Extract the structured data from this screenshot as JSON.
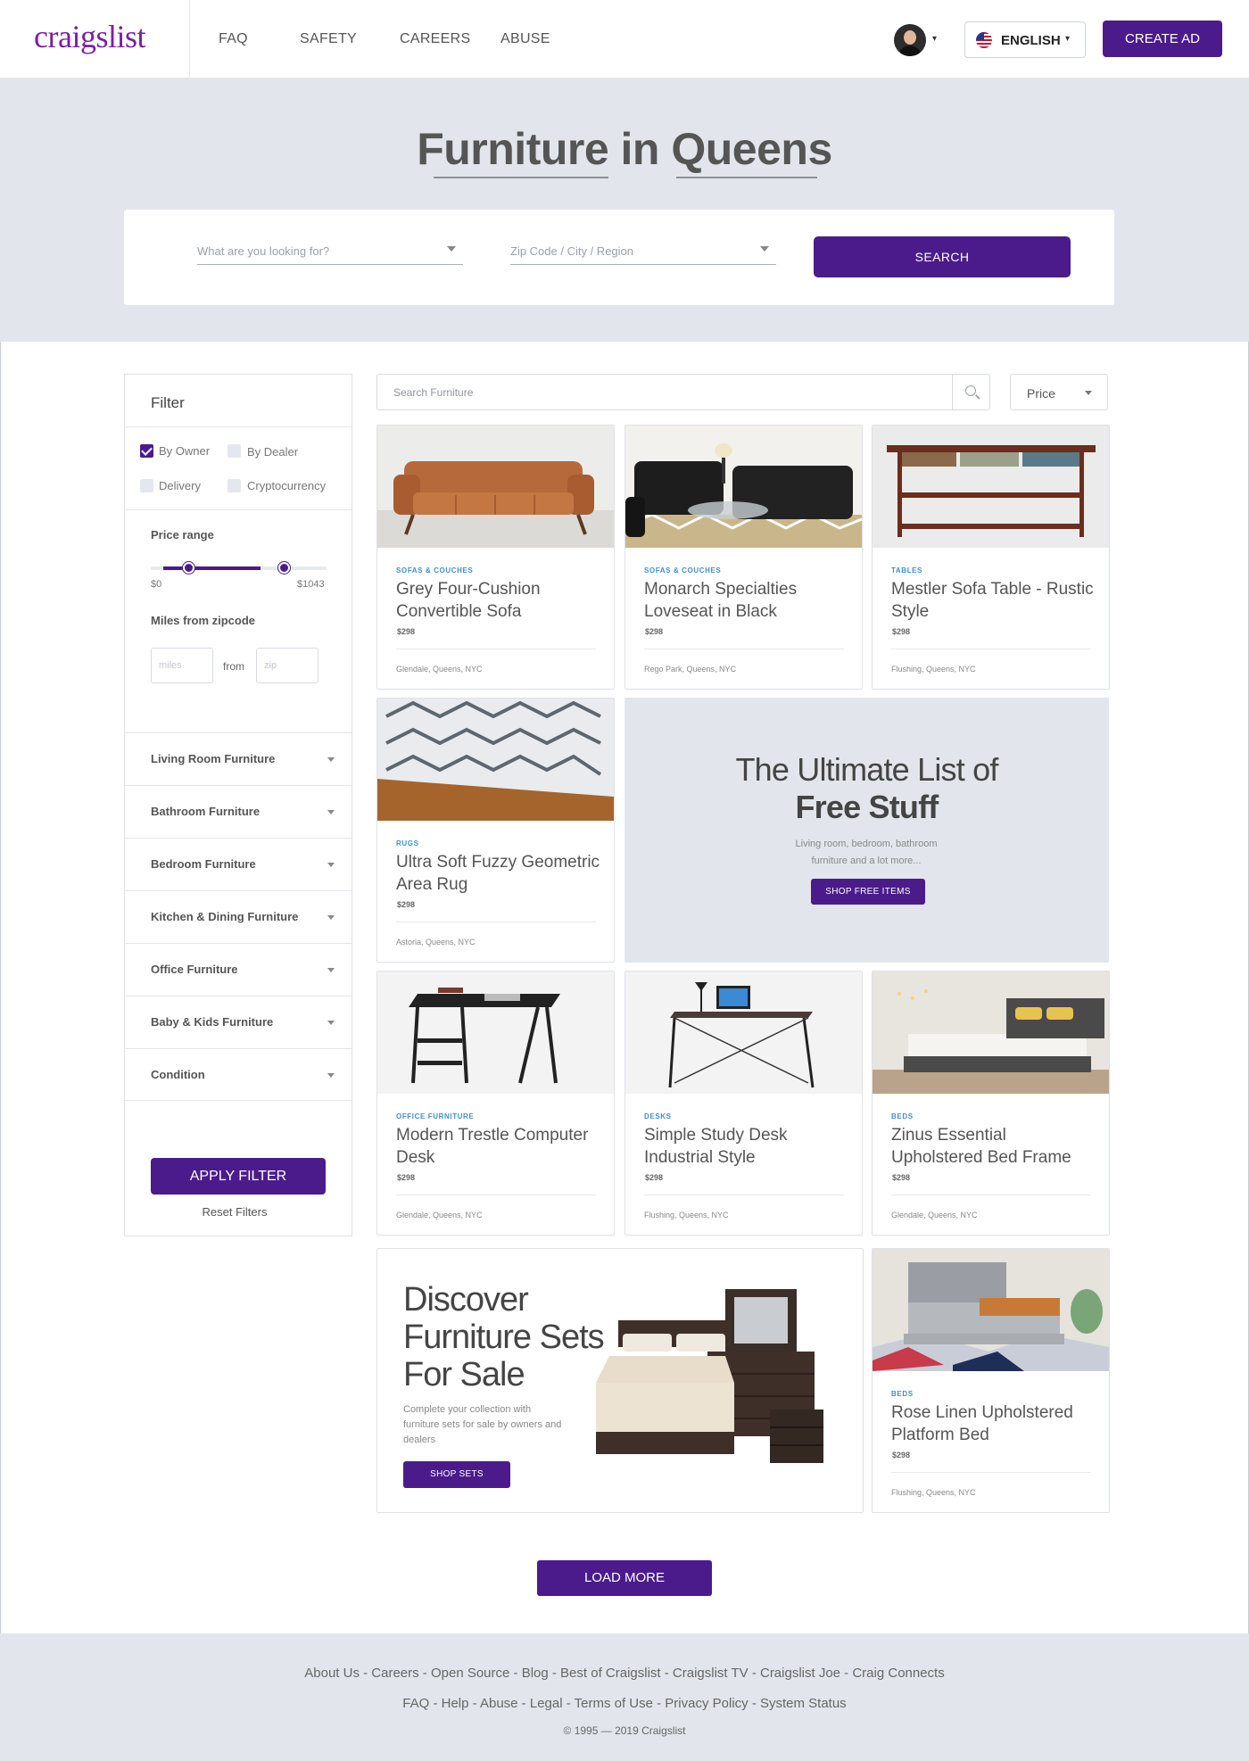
{
  "header": {
    "logo": "craigslist",
    "nav": [
      "FAQ",
      "SAFETY",
      "CAREERS",
      "ABUSE"
    ],
    "language": "ENGLISH",
    "create_ad": "CREATE AD"
  },
  "hero": {
    "title": "Furniture in Queens",
    "search_placeholder": "What are you looking for?",
    "location_placeholder": "Zip Code / City / Region",
    "search_button": "SEARCH"
  },
  "filter": {
    "title": "Filter",
    "checkboxes": [
      {
        "label": "By Owner",
        "checked": true
      },
      {
        "label": "By Dealer",
        "checked": false
      },
      {
        "label": "Delivery",
        "checked": false
      },
      {
        "label": "Cryptocurrency",
        "checked": false
      }
    ],
    "price_range_label": "Price range",
    "price_min": "$0",
    "price_max": "$1043",
    "miles_label": "Miles from zipcode",
    "miles_placeholder": "miles",
    "from_label": "from",
    "zip_placeholder": "zip",
    "categories": [
      "Living Room Furniture",
      "Bathroom Furniture",
      "Bedroom Furniture",
      "Kitchen & Dining Furniture",
      "Office Furniture",
      "Baby & Kids Furniture",
      "Condition"
    ],
    "apply_button": "APPLY FILTER",
    "reset_link": "Reset Filters"
  },
  "toolbar": {
    "search_placeholder": "Search Furniture",
    "sort_label": "Price"
  },
  "listings": [
    {
      "category": "SOFAS & COUCHES",
      "title": "Grey Four-Cushion Convertible Sofa",
      "price": "$298",
      "location": "Glendale, Queens, NYC"
    },
    {
      "category": "SOFAS & COUCHES",
      "title": "Monarch Specialties Loveseat in Black",
      "price": "$298",
      "location": "Rego Park, Queens, NYC"
    },
    {
      "category": "TABLES",
      "title": "Mestler Sofa Table - Rustic Style",
      "price": "$298",
      "location": "Flushing, Queens, NYC"
    },
    {
      "category": "RUGS",
      "title": "Ultra Soft Fuzzy Geometric Area Rug",
      "price": "$298",
      "location": "Astoria, Queens, NYC"
    },
    {
      "category": "OFFICE FURNITURE",
      "title": "Modern Trestle Computer Desk",
      "price": "$298",
      "location": "Glendale, Queens, NYC"
    },
    {
      "category": "DESKS",
      "title": "Simple Study Desk Industrial Style",
      "price": "$298",
      "location": "Flushing, Queens, NYC"
    },
    {
      "category": "BEDS",
      "title": "Zinus Essential Upholstered Bed Frame",
      "price": "$298",
      "location": "Glendale, Queens, NYC"
    },
    {
      "category": "BEDS",
      "title": "Rose Linen Upholstered Platform Bed",
      "price": "$298",
      "location": "Flushing, Queens, NYC"
    }
  ],
  "promo_free": {
    "title_line1": "The Ultimate List of",
    "title_line2": "Free Stuff",
    "description": "Living room, bedroom, bathroom furniture and a lot more...",
    "button": "SHOP FREE ITEMS"
  },
  "promo_sets": {
    "title": "Discover Furniture Sets For Sale",
    "description": "Complete your collection with furniture sets for sale by owners and dealers",
    "button": "SHOP SETS"
  },
  "load_more": "LOAD MORE",
  "footer": {
    "line1": "About Us - Careers - Open Source - Blog - Best of Craigslist - Craigslist TV - Craigslist Joe - Craig Connects",
    "line2": "FAQ - Help - Abuse - Legal - Terms of Use - Privacy Policy - System Status",
    "copyright": "© 1995 — 2019 Craigslist"
  },
  "colors": {
    "brand_purple": "#4b1b8c",
    "logo_purple": "#7b1fa2",
    "hero_bg": "#e2e6ec",
    "category_blue": "#3f8fd0"
  }
}
